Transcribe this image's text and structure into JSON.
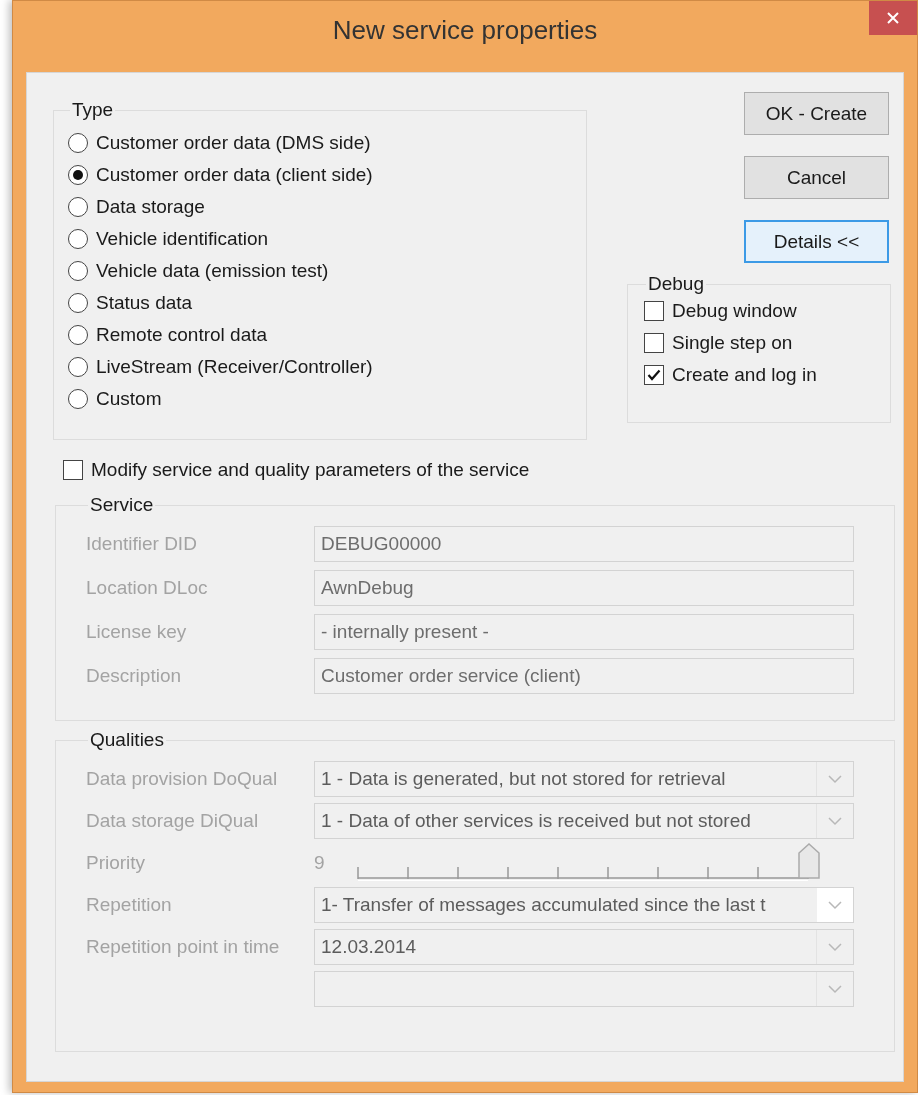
{
  "window": {
    "title": "New service properties"
  },
  "type_group": {
    "title": "Type",
    "options": [
      {
        "label": "Customer order data (DMS side)",
        "selected": false
      },
      {
        "label": "Customer order data (client side)",
        "selected": true
      },
      {
        "label": "Data storage",
        "selected": false
      },
      {
        "label": "Vehicle identification",
        "selected": false
      },
      {
        "label": "Vehicle data (emission test)",
        "selected": false
      },
      {
        "label": "Status data",
        "selected": false
      },
      {
        "label": "Remote control data",
        "selected": false
      },
      {
        "label": "LiveStream (Receiver/Controller)",
        "selected": false
      },
      {
        "label": "Custom",
        "selected": false
      }
    ]
  },
  "buttons": [
    {
      "label": "OK - Create",
      "focused": false
    },
    {
      "label": "Cancel",
      "focused": false
    },
    {
      "label": "Details <<",
      "focused": true
    }
  ],
  "debug_group": {
    "title": "Debug",
    "options": [
      {
        "label": "Debug window",
        "checked": false
      },
      {
        "label": "Single step on",
        "checked": false
      },
      {
        "label": "Create and log in",
        "checked": true
      }
    ]
  },
  "modify": {
    "label": "Modify service and quality parameters of the service",
    "checked": false
  },
  "service": {
    "title": "Service",
    "disabled": true,
    "fields": [
      {
        "label": "Identifier DID",
        "value": "DEBUG00000"
      },
      {
        "label": "Location DLoc",
        "value": "AwnDebug"
      },
      {
        "label": "License key",
        "value": "- internally present -"
      },
      {
        "label": "Description",
        "value": "Customer order service (client)"
      }
    ]
  },
  "qualities": {
    "title": "Qualities",
    "disabled": true,
    "rows": [
      {
        "kind": "combo",
        "label": "Data provision DoQual",
        "value": "1 - Data is generated, but not stored for retrieval"
      },
      {
        "kind": "combo",
        "label": "Data storage DiQual",
        "value": "1 - Data of other services is received but not stored"
      },
      {
        "kind": "slider",
        "label": "Priority",
        "reading": "9",
        "level": 1
      },
      {
        "kind": "combo",
        "label": "Repetition",
        "value": "1- Transfer of messages accumulated since the last t"
      },
      {
        "kind": "combo",
        "label": "Repetition point in time",
        "value": "12.03.2014"
      },
      {
        "kind": "combo"
      }
    ]
  }
}
